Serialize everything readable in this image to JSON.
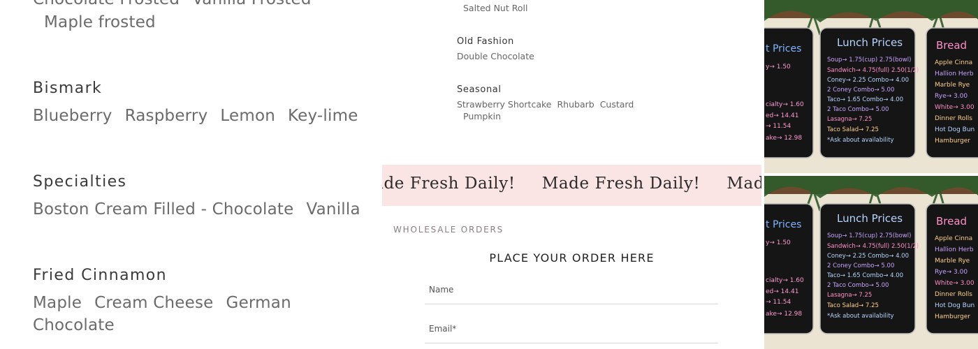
{
  "menu": {
    "frosted_line_top": [
      "Chocolate Frosted",
      "Vanilla Frosted"
    ],
    "frosted_line_second": "Maple frosted",
    "bismark": {
      "title": "Bismark",
      "items": [
        "Blueberry",
        "Raspberry",
        "Lemon",
        "Key-lime"
      ]
    },
    "specialties": {
      "title": "Specialties",
      "items": [
        "Boston Cream Filled - Chocolate",
        "Vanilla"
      ]
    },
    "fried_cinnamon": {
      "title": "Fried Cinnamon",
      "items": [
        "Maple",
        "Cream Cheese",
        "German"
      ],
      "continuation": "Chocolate"
    }
  },
  "side_menu": {
    "top_item": "Salted Nut Roll",
    "old_fashion": {
      "title": "Old Fashion",
      "items": [
        "Double Chocolate"
      ]
    },
    "seasonal": {
      "title": "Seasonal",
      "items": [
        "Strawberry Shortcake",
        "Rhubarb",
        "Custard"
      ],
      "continuation": "Pumpkin"
    }
  },
  "banner": {
    "text": "Made Fresh Daily!",
    "bg_color": "#fbe4e4"
  },
  "order_form": {
    "section_label": "WHOLESALE ORDERS",
    "heading": "PLACE YOUR ORDER HERE",
    "name_placeholder": "Name",
    "email_placeholder": "Email*"
  },
  "photos": {
    "board_headings": [
      "t Prices",
      "Lunch Prices",
      "Bread"
    ],
    "left_board": [
      "y→ 1.50",
      "cialty→ 1.60",
      "ed→ 14.41",
      "→ 11.54",
      "ake→ 12.98"
    ],
    "middle_board": [
      "Soup→ 1.75(cup) 2.75(bowl)",
      "Sandwich→ 4.75(full) 2.50(1/2)",
      "Coney→ 2.25  Combo→ 4.00",
      "2 Coney Combo→ 5.00",
      "Taco→ 1.65  Combo→ 4.00",
      "2 Taco Combo→ 5.00",
      "Lasagna→ 7.25",
      "Taco Salad→ 7.25",
      "*Ask about availability"
    ],
    "right_board": [
      "Apple Cinna",
      "Hallion Herb",
      "Marble Rye",
      "Rye→ 3.00",
      "White→ 3.00",
      "Dinner Rolls",
      "Hot Dog Bun",
      "Hamburger"
    ]
  }
}
